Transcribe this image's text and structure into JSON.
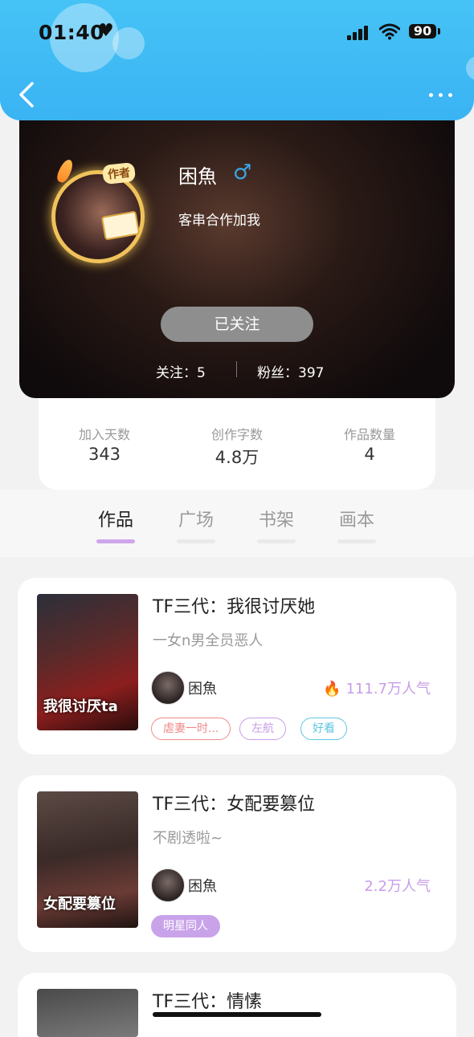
{
  "status_bar": {
    "time": "01:40",
    "heart": "♥",
    "battery": "90"
  },
  "header": {
    "back_label": "<",
    "more_label": "•••"
  },
  "profile": {
    "author_tag": "作者",
    "name": "困魚",
    "gender_symbol": "♂",
    "bio": "客串合作加我",
    "follow_button": "已关注",
    "following": "关注：5",
    "fans": "粉丝：397"
  },
  "stats": [
    {
      "label": "加入天数",
      "value": "343"
    },
    {
      "label": "创作字数",
      "value": "4.8万"
    },
    {
      "label": "作品数量",
      "value": "4"
    }
  ],
  "tabs": [
    {
      "label": "作品",
      "active": true
    },
    {
      "label": "广场",
      "active": false
    },
    {
      "label": "书架",
      "active": false
    },
    {
      "label": "画本",
      "active": false
    }
  ],
  "books": [
    {
      "title": "TF三代：我很讨厌她",
      "description": "一女n男全员恶人",
      "cover_text": "我很讨厌ta",
      "author": "困魚",
      "popularity": "111.7万人气",
      "popularity_icon": "flame-icon",
      "tags": [
        {
          "label": "虐妻一时...",
          "color": "#f08a8a"
        },
        {
          "label": "左航",
          "color": "#c89de8"
        },
        {
          "label": "好看",
          "color": "#5ec6e0"
        }
      ]
    },
    {
      "title": "TF三代：女配要篡位",
      "description": "不剧透啦~",
      "cover_text": "女配要篡位",
      "author": "困魚",
      "popularity": "2.2万人气",
      "tags": [
        {
          "label": "明星同人",
          "color": "#c9a3ea"
        }
      ]
    },
    {
      "title": "TF三代：情愫",
      "cover_text": ""
    }
  ],
  "colors": {
    "header": "#46c3f6",
    "accent": "#cfa6ea",
    "gender": "#3aa6e8"
  }
}
